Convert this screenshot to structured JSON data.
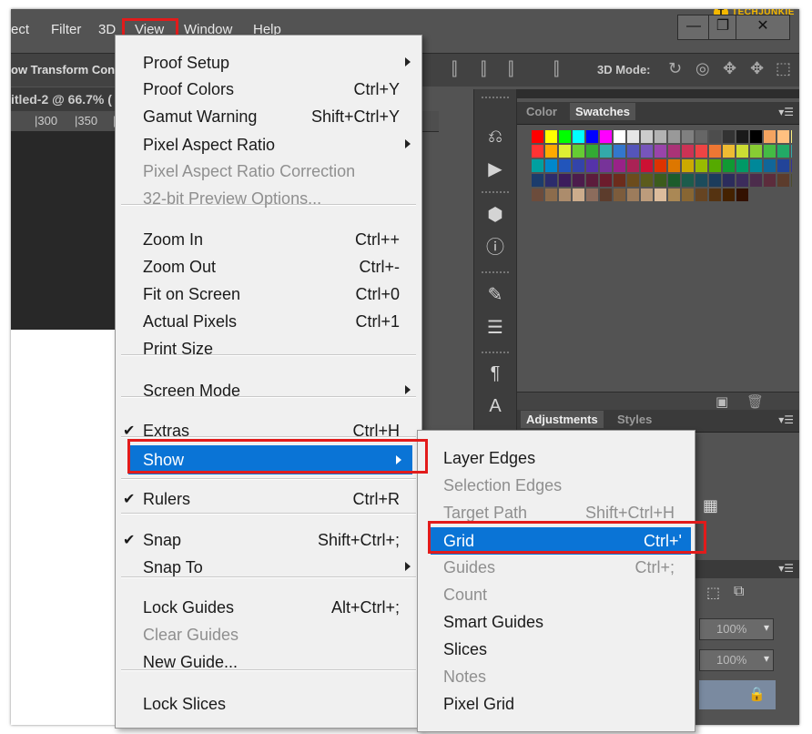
{
  "menubar": {
    "items": [
      "ect",
      "Filter",
      "3D",
      "View",
      "Window",
      "Help"
    ],
    "minimize": "—",
    "restore": "❐",
    "close": "✕"
  },
  "watermark": {
    "logo_letter": "T",
    "text": "TECHJUNKIE"
  },
  "options_bar": {
    "label": "ow Transform Contr",
    "mode_label": "3D Mode:"
  },
  "document": {
    "tab_title": "itled-2 @ 66.7% (",
    "ruler_ticks": [
      "|300",
      "|350",
      "|4"
    ]
  },
  "panels": {
    "color_tab": "Color",
    "swatches_tab": "Swatches",
    "adjustments_tab": "Adjustments",
    "styles_tab": "Styles",
    "opacity_1": "100%",
    "opacity_2": "100%"
  },
  "swatch_colors": [
    [
      "#ff0000",
      "#ffff00",
      "#00ff00",
      "#00ffff",
      "#0000ff",
      "#ff00ff",
      "#ffffff",
      "#e6e6e6",
      "#cccccc",
      "#b3b3b3",
      "#999999",
      "#808080",
      "#666666",
      "#4d4d4d",
      "#333333",
      "#1a1a1a",
      "#000000",
      "#f4a460",
      "#ffc080",
      "#fff080",
      "#ffffa0"
    ],
    [
      "#ff3333",
      "#ffaa00",
      "#ddee33",
      "#66cc33",
      "#33aa33",
      "#33aaaa",
      "#3377cc",
      "#5555bb",
      "#7755bb",
      "#9944aa",
      "#aa3377",
      "#cc3355",
      "#ee4444",
      "#ee7733",
      "#eebb33",
      "#ccdd33",
      "#88cc33",
      "#44bb44",
      "#22aa66",
      "#33aaaa",
      "#8899dd"
    ],
    [
      "#00a0a0",
      "#0088cc",
      "#2255bb",
      "#3344aa",
      "#5533aa",
      "#773399",
      "#992288",
      "#aa2255",
      "#cc1133",
      "#dd3300",
      "#dd7700",
      "#ccaa00",
      "#99bb00",
      "#55aa00",
      "#119933",
      "#009966",
      "#008899",
      "#116699",
      "#224499",
      "#333399",
      "#553399"
    ],
    [
      "#1c3c6c",
      "#2c2c6c",
      "#3c1c5c",
      "#4c1c4c",
      "#5c1c3c",
      "#6c1c2c",
      "#6c2c1c",
      "#6c4c1c",
      "#5c5c1c",
      "#3c5c1c",
      "#1c5c2c",
      "#1c5c4c",
      "#1c4c5c",
      "#1c3c5c",
      "#2c2c5c",
      "#3c2c5c",
      "#4c2c4c",
      "#5c2c3c",
      "#5c3c2c",
      "#4c4c2c",
      "#2c4c2c"
    ],
    [
      "#6c4c3c",
      "#8c6c4c",
      "#ac8c6c",
      "#ccac8c",
      "#8c6c5c",
      "#5c3c2c",
      "#7c5c3c",
      "#9c7c5c",
      "#bc9c7c",
      "#dcbc9c",
      "#aa8855",
      "#886633",
      "#664422",
      "#553311",
      "#442200",
      "#331100"
    ]
  ],
  "view_menu": {
    "items": [
      {
        "label": "Proof Setup",
        "shortcut": "",
        "submenu": true,
        "disabled": false
      },
      {
        "label": "Proof Colors",
        "shortcut": "Ctrl+Y"
      },
      {
        "label": "Gamut Warning",
        "shortcut": "Shift+Ctrl+Y"
      },
      {
        "label": "Pixel Aspect Ratio",
        "shortcut": "",
        "submenu": true
      },
      {
        "label": "Pixel Aspect Ratio Correction",
        "shortcut": "",
        "disabled": true
      },
      {
        "label": "32-bit Preview Options...",
        "shortcut": "",
        "disabled": true
      },
      {
        "label": "Zoom In",
        "shortcut": "Ctrl++"
      },
      {
        "label": "Zoom Out",
        "shortcut": "Ctrl+-"
      },
      {
        "label": "Fit on Screen",
        "shortcut": "Ctrl+0"
      },
      {
        "label": "Actual Pixels",
        "shortcut": "Ctrl+1"
      },
      {
        "label": "Print Size",
        "shortcut": ""
      },
      {
        "label": "Screen Mode",
        "shortcut": "",
        "submenu": true
      },
      {
        "label": "Extras",
        "shortcut": "Ctrl+H",
        "checked": true
      },
      {
        "label": "Show",
        "shortcut": "",
        "submenu": true,
        "highlighted": true
      },
      {
        "label": "Rulers",
        "shortcut": "Ctrl+R",
        "checked": true
      },
      {
        "label": "Snap",
        "shortcut": "Shift+Ctrl+;",
        "checked": true
      },
      {
        "label": "Snap To",
        "shortcut": "",
        "submenu": true
      },
      {
        "label": "Lock Guides",
        "shortcut": "Alt+Ctrl+;"
      },
      {
        "label": "Clear Guides",
        "shortcut": "",
        "disabled": true
      },
      {
        "label": "New Guide...",
        "shortcut": ""
      },
      {
        "label": "Lock Slices",
        "shortcut": ""
      }
    ],
    "check_glyph": "✔"
  },
  "show_submenu": {
    "items": [
      {
        "label": "Layer Edges",
        "shortcut": ""
      },
      {
        "label": "Selection Edges",
        "shortcut": "",
        "disabled": true
      },
      {
        "label": "Target Path",
        "shortcut": "Shift+Ctrl+H",
        "disabled": true
      },
      {
        "label": "Grid",
        "shortcut": "Ctrl+'",
        "highlighted": true
      },
      {
        "label": "Guides",
        "shortcut": "Ctrl+;",
        "disabled": true
      },
      {
        "label": "Count",
        "shortcut": "",
        "disabled": true
      },
      {
        "label": "Smart Guides",
        "shortcut": ""
      },
      {
        "label": "Slices",
        "shortcut": ""
      },
      {
        "label": "Notes",
        "shortcut": "",
        "disabled": true
      },
      {
        "label": "Pixel Grid",
        "shortcut": ""
      }
    ]
  },
  "colors": {
    "highlight": "#0a74d6",
    "callout": "#e21b1b",
    "menu_bg": "#f0f0f0",
    "app_bg": "#535353"
  }
}
